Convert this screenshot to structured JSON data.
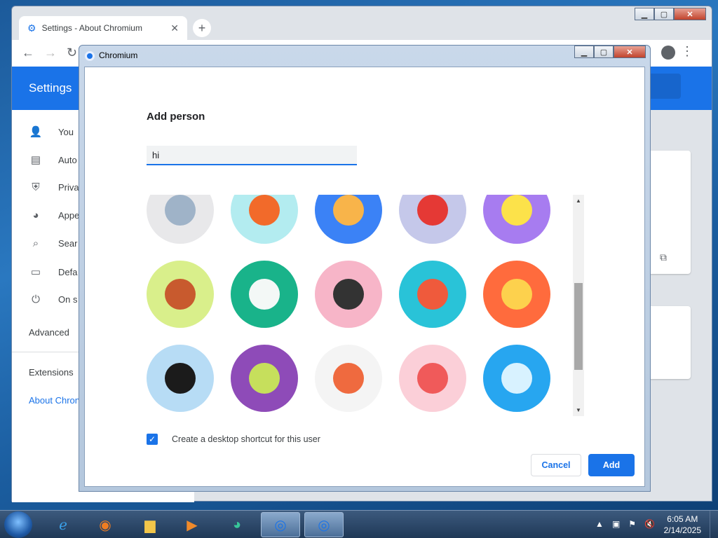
{
  "browser": {
    "tab_title": "Settings - About Chromium",
    "tab_close_icon": "close-icon",
    "new_tab_symbol": "+",
    "settings_title": "Settings",
    "sidebar": [
      {
        "icon": "person-icon",
        "label": "You"
      },
      {
        "icon": "clipboard-icon",
        "label": "Auto"
      },
      {
        "icon": "shield-icon",
        "label": "Priva"
      },
      {
        "icon": "palette-icon",
        "label": "Appe"
      },
      {
        "icon": "search-icon",
        "label": "Sear"
      },
      {
        "icon": "browser-icon",
        "label": "Defa"
      },
      {
        "icon": "power-icon",
        "label": "On s"
      }
    ],
    "advanced": "Advanced",
    "extensions": "Extensions",
    "about": "About Chron"
  },
  "dialog": {
    "window_title": "Chromium",
    "heading": "Add person",
    "name_value": "hi",
    "shortcut_label": "Create a desktop shortcut for this user",
    "shortcut_checked": true,
    "cancel_label": "Cancel",
    "add_label": "Add",
    "avatars": [
      {
        "name": "origami-avatar",
        "bg": "#e8e8ea",
        "fg": "#9fb3c8"
      },
      {
        "name": "basketball-avatar",
        "bg": "#b3ecf0",
        "fg": "#f26a2a"
      },
      {
        "name": "bicycle-avatar",
        "bg": "#3b82f6",
        "fg": "#f8b44a"
      },
      {
        "name": "bird-avatar",
        "bg": "#c5c8ea",
        "fg": "#e53935"
      },
      {
        "name": "cheese-avatar",
        "bg": "#a77cf0",
        "fg": "#fce24a"
      },
      {
        "name": "football-avatar",
        "bg": "#d9ef8b",
        "fg": "#c85a2e"
      },
      {
        "name": "noodles-avatar",
        "bg": "#19b38a",
        "fg": "#f3f8f6"
      },
      {
        "name": "sunglasses-avatar",
        "bg": "#f7b5c8",
        "fg": "#333333"
      },
      {
        "name": "sushi-avatar",
        "bg": "#29c3d8",
        "fg": "#ef5a3c"
      },
      {
        "name": "game-avatar",
        "bg": "#ff6b3d",
        "fg": "#fdd14d"
      },
      {
        "name": "vinyl-avatar",
        "bg": "#b7dcf5",
        "fg": "#1b1b1b"
      },
      {
        "name": "avocado-avatar",
        "bg": "#8e4bb8",
        "fg": "#c6df5c"
      },
      {
        "name": "smile-avatar",
        "bg": "#f4f4f4",
        "fg": "#ef6a3f"
      },
      {
        "name": "icecream-avatar",
        "bg": "#fbcfd8",
        "fg": "#f05a5a"
      },
      {
        "name": "icecubes-avatar",
        "bg": "#27a6f0",
        "fg": "#d8f2ff"
      }
    ]
  },
  "taskbar": {
    "items": [
      "ie-icon",
      "firefox-icon",
      "folder-icon",
      "media-icon",
      "app-icon",
      "chromium-icon",
      "chromium-icon"
    ],
    "time": "6:05 AM",
    "date": "2/14/2025"
  }
}
